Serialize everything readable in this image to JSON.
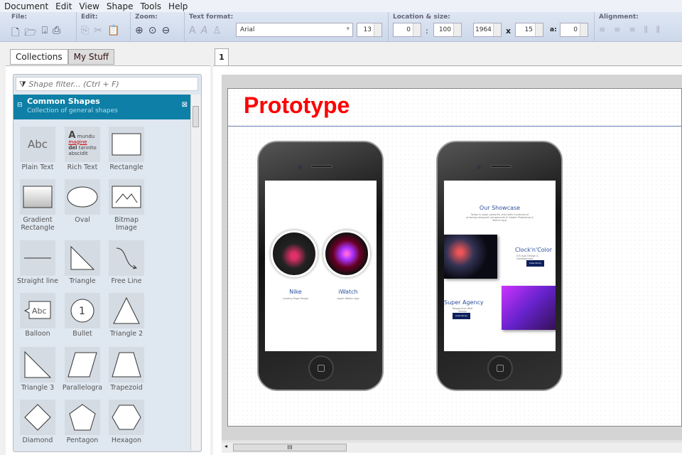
{
  "menu": [
    "Document",
    "Edit",
    "View",
    "Shape",
    "Tools",
    "Help"
  ],
  "toolbar": {
    "file": "File:",
    "edit": "Edit:",
    "zoom": "Zoom:",
    "text_format": "Text format:",
    "font": "Arial",
    "font_size": "13",
    "location_size": "Location & size:",
    "x": "0",
    "y": "100",
    "sep": ":",
    "width": "1964",
    "times": "x",
    "height": "15",
    "angle_label": "a:",
    "angle": "0",
    "alignment": "Alignment:"
  },
  "sidebar": {
    "tabs": [
      "Collections",
      "My Stuff"
    ],
    "filter_placeholder": "Shape filter... (Ctrl + F)",
    "collection": {
      "title": "Common Shapes",
      "subtitle": "Collection of general shapes"
    },
    "shapes": [
      "Plain Text",
      "Rich Text",
      "Rectangle",
      "Gradient Rectangle",
      "Oval",
      "Bitmap Image",
      "Straight line",
      "Triangle",
      "Free Line",
      "Balloon",
      "Bullet",
      "Triangle 2",
      "Triangle 3",
      "Parallelogra",
      "Trapezoid",
      "Diamond",
      "Pentagon",
      "Hexagon"
    ],
    "rich_text_sample": [
      "A",
      "mundu",
      "magine",
      "del",
      "tannito",
      "abscidit"
    ],
    "abc": "Abc",
    "bullet_num": "1"
  },
  "doc_tab": "1",
  "canvas": {
    "title": "Prototype",
    "title_color": "#ff0000",
    "phone1": {
      "items": [
        {
          "name": "Nike",
          "sub": "Landing Page Design"
        },
        {
          "name": "iWatch",
          "sub": "Apple iWatch App"
        }
      ]
    },
    "phone2": {
      "heading": "Our Showcase",
      "intro": "Today is super powerful child with hundreds of amazing designed components in Adobe Photoshop & Sketch App.",
      "items": [
        {
          "name": "Clock'n'Color",
          "sub": "iOS App Design & Development",
          "button": "Case Study"
        },
        {
          "name": "Super Agency",
          "sub": "Responsive Web Design",
          "button": "Case Study"
        }
      ]
    }
  },
  "scroll_grip": "III",
  "colors": {
    "accent": "#0e7fa6",
    "toolbar": "#d5dfee"
  }
}
